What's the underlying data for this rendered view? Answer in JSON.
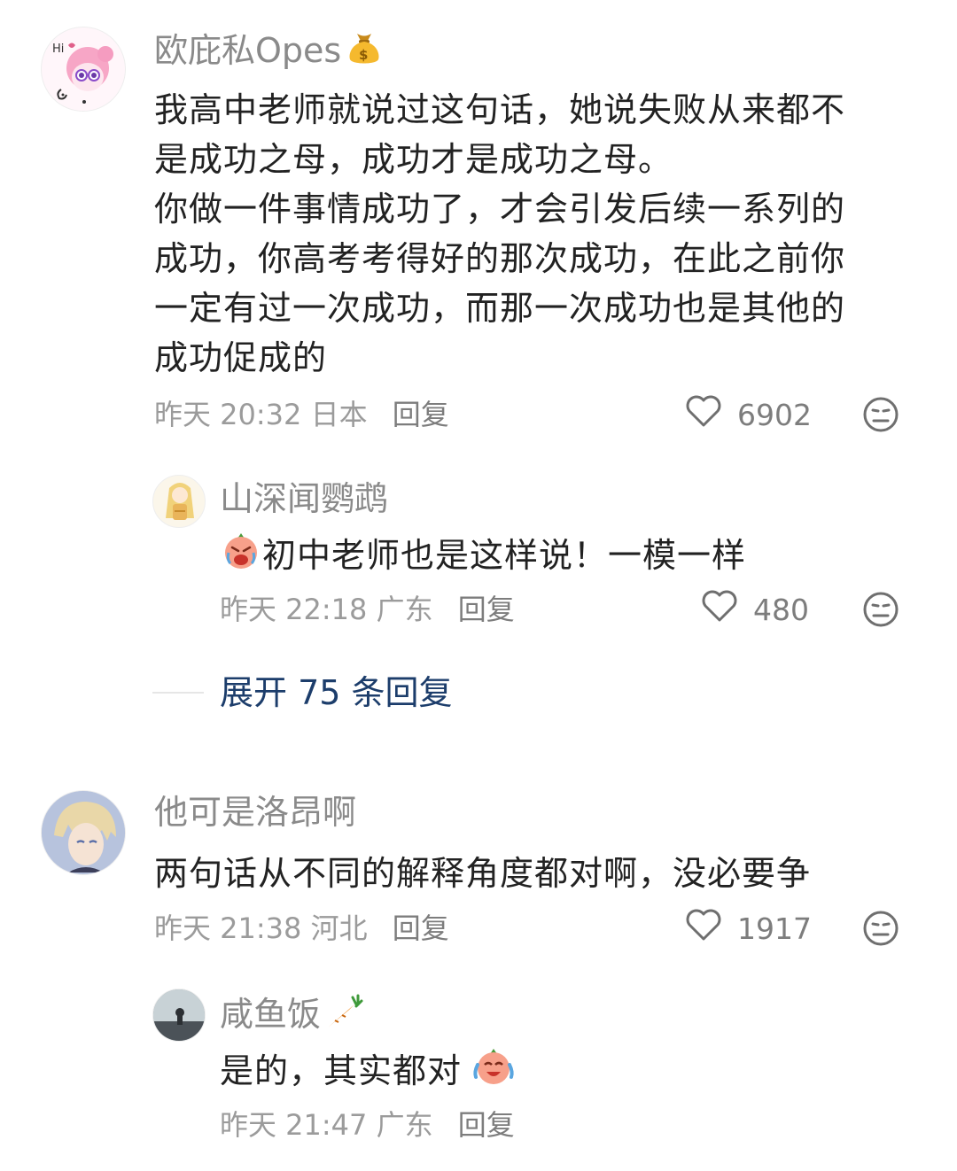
{
  "comments": [
    {
      "username": "欧庇私Opes",
      "username_emoji": "money-bag-icon",
      "content_lines": [
        "我高中老师就说过这句话，她说失败从来都不",
        "是成功之母，成功才是成功之母。",
        "你做一件事情成功了，才会引发后续一系列的",
        "成功，你高考考得好的那次成功，在此之前你",
        "一定有过一次成功，而那一次成功也是其他的",
        "成功促成的"
      ],
      "time": "昨天 20:32",
      "location": "日本",
      "reply_label": "回复",
      "likes": "6902",
      "replies": [
        {
          "username": "山深闻鹦鹉",
          "content": "初中老师也是这样说！一模一样",
          "content_emoji": "crying-face-icon",
          "time": "昨天 22:18",
          "location": "广东",
          "reply_label": "回复",
          "likes": "480"
        }
      ],
      "expand_label": "展开 75 条回复"
    },
    {
      "username": "他可是洛昂啊",
      "content_lines": [
        "两句话从不同的解释角度都对啊，没必要争"
      ],
      "time": "昨天 21:38",
      "location": "河北",
      "reply_label": "回复",
      "likes": "1917",
      "replies": [
        {
          "username": "咸鱼饭",
          "username_emoji": "carrot-icon",
          "content": "是的，其实都对",
          "content_emoji": "laughing-tears-face-icon",
          "time": "昨天 21:47",
          "location": "广东",
          "reply_label": "回复",
          "likes": ""
        }
      ]
    }
  ],
  "colors": {
    "text": "#222222",
    "username": "#8a8a8a",
    "meta": "#9b9b9b",
    "link": "#1c3d6b"
  }
}
